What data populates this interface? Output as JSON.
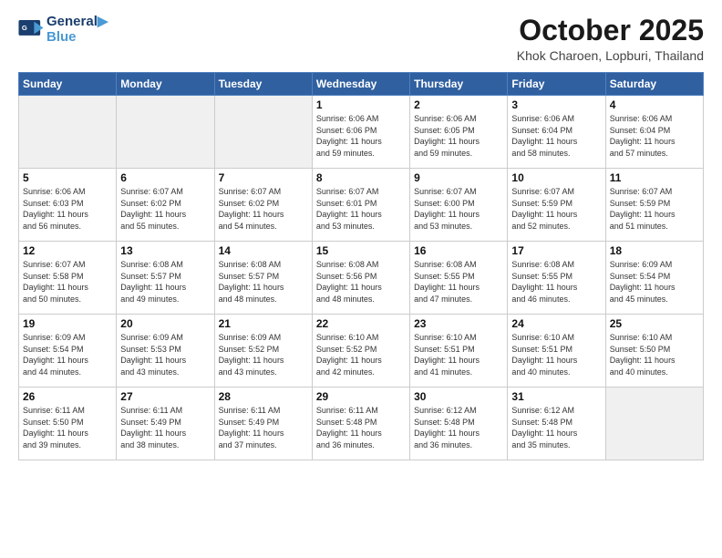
{
  "header": {
    "logo_line1": "General",
    "logo_line2": "Blue",
    "month": "October 2025",
    "location": "Khok Charoen, Lopburi, Thailand"
  },
  "weekdays": [
    "Sunday",
    "Monday",
    "Tuesday",
    "Wednesday",
    "Thursday",
    "Friday",
    "Saturday"
  ],
  "weeks": [
    [
      {
        "day": "",
        "lines": [],
        "empty": true
      },
      {
        "day": "",
        "lines": [],
        "empty": true
      },
      {
        "day": "",
        "lines": [],
        "empty": true
      },
      {
        "day": "1",
        "lines": [
          "Sunrise: 6:06 AM",
          "Sunset: 6:06 PM",
          "Daylight: 11 hours",
          "and 59 minutes."
        ],
        "empty": false
      },
      {
        "day": "2",
        "lines": [
          "Sunrise: 6:06 AM",
          "Sunset: 6:05 PM",
          "Daylight: 11 hours",
          "and 59 minutes."
        ],
        "empty": false
      },
      {
        "day": "3",
        "lines": [
          "Sunrise: 6:06 AM",
          "Sunset: 6:04 PM",
          "Daylight: 11 hours",
          "and 58 minutes."
        ],
        "empty": false
      },
      {
        "day": "4",
        "lines": [
          "Sunrise: 6:06 AM",
          "Sunset: 6:04 PM",
          "Daylight: 11 hours",
          "and 57 minutes."
        ],
        "empty": false
      }
    ],
    [
      {
        "day": "5",
        "lines": [
          "Sunrise: 6:06 AM",
          "Sunset: 6:03 PM",
          "Daylight: 11 hours",
          "and 56 minutes."
        ],
        "empty": false
      },
      {
        "day": "6",
        "lines": [
          "Sunrise: 6:07 AM",
          "Sunset: 6:02 PM",
          "Daylight: 11 hours",
          "and 55 minutes."
        ],
        "empty": false
      },
      {
        "day": "7",
        "lines": [
          "Sunrise: 6:07 AM",
          "Sunset: 6:02 PM",
          "Daylight: 11 hours",
          "and 54 minutes."
        ],
        "empty": false
      },
      {
        "day": "8",
        "lines": [
          "Sunrise: 6:07 AM",
          "Sunset: 6:01 PM",
          "Daylight: 11 hours",
          "and 53 minutes."
        ],
        "empty": false
      },
      {
        "day": "9",
        "lines": [
          "Sunrise: 6:07 AM",
          "Sunset: 6:00 PM",
          "Daylight: 11 hours",
          "and 53 minutes."
        ],
        "empty": false
      },
      {
        "day": "10",
        "lines": [
          "Sunrise: 6:07 AM",
          "Sunset: 5:59 PM",
          "Daylight: 11 hours",
          "and 52 minutes."
        ],
        "empty": false
      },
      {
        "day": "11",
        "lines": [
          "Sunrise: 6:07 AM",
          "Sunset: 5:59 PM",
          "Daylight: 11 hours",
          "and 51 minutes."
        ],
        "empty": false
      }
    ],
    [
      {
        "day": "12",
        "lines": [
          "Sunrise: 6:07 AM",
          "Sunset: 5:58 PM",
          "Daylight: 11 hours",
          "and 50 minutes."
        ],
        "empty": false
      },
      {
        "day": "13",
        "lines": [
          "Sunrise: 6:08 AM",
          "Sunset: 5:57 PM",
          "Daylight: 11 hours",
          "and 49 minutes."
        ],
        "empty": false
      },
      {
        "day": "14",
        "lines": [
          "Sunrise: 6:08 AM",
          "Sunset: 5:57 PM",
          "Daylight: 11 hours",
          "and 48 minutes."
        ],
        "empty": false
      },
      {
        "day": "15",
        "lines": [
          "Sunrise: 6:08 AM",
          "Sunset: 5:56 PM",
          "Daylight: 11 hours",
          "and 48 minutes."
        ],
        "empty": false
      },
      {
        "day": "16",
        "lines": [
          "Sunrise: 6:08 AM",
          "Sunset: 5:55 PM",
          "Daylight: 11 hours",
          "and 47 minutes."
        ],
        "empty": false
      },
      {
        "day": "17",
        "lines": [
          "Sunrise: 6:08 AM",
          "Sunset: 5:55 PM",
          "Daylight: 11 hours",
          "and 46 minutes."
        ],
        "empty": false
      },
      {
        "day": "18",
        "lines": [
          "Sunrise: 6:09 AM",
          "Sunset: 5:54 PM",
          "Daylight: 11 hours",
          "and 45 minutes."
        ],
        "empty": false
      }
    ],
    [
      {
        "day": "19",
        "lines": [
          "Sunrise: 6:09 AM",
          "Sunset: 5:54 PM",
          "Daylight: 11 hours",
          "and 44 minutes."
        ],
        "empty": false
      },
      {
        "day": "20",
        "lines": [
          "Sunrise: 6:09 AM",
          "Sunset: 5:53 PM",
          "Daylight: 11 hours",
          "and 43 minutes."
        ],
        "empty": false
      },
      {
        "day": "21",
        "lines": [
          "Sunrise: 6:09 AM",
          "Sunset: 5:52 PM",
          "Daylight: 11 hours",
          "and 43 minutes."
        ],
        "empty": false
      },
      {
        "day": "22",
        "lines": [
          "Sunrise: 6:10 AM",
          "Sunset: 5:52 PM",
          "Daylight: 11 hours",
          "and 42 minutes."
        ],
        "empty": false
      },
      {
        "day": "23",
        "lines": [
          "Sunrise: 6:10 AM",
          "Sunset: 5:51 PM",
          "Daylight: 11 hours",
          "and 41 minutes."
        ],
        "empty": false
      },
      {
        "day": "24",
        "lines": [
          "Sunrise: 6:10 AM",
          "Sunset: 5:51 PM",
          "Daylight: 11 hours",
          "and 40 minutes."
        ],
        "empty": false
      },
      {
        "day": "25",
        "lines": [
          "Sunrise: 6:10 AM",
          "Sunset: 5:50 PM",
          "Daylight: 11 hours",
          "and 40 minutes."
        ],
        "empty": false
      }
    ],
    [
      {
        "day": "26",
        "lines": [
          "Sunrise: 6:11 AM",
          "Sunset: 5:50 PM",
          "Daylight: 11 hours",
          "and 39 minutes."
        ],
        "empty": false
      },
      {
        "day": "27",
        "lines": [
          "Sunrise: 6:11 AM",
          "Sunset: 5:49 PM",
          "Daylight: 11 hours",
          "and 38 minutes."
        ],
        "empty": false
      },
      {
        "day": "28",
        "lines": [
          "Sunrise: 6:11 AM",
          "Sunset: 5:49 PM",
          "Daylight: 11 hours",
          "and 37 minutes."
        ],
        "empty": false
      },
      {
        "day": "29",
        "lines": [
          "Sunrise: 6:11 AM",
          "Sunset: 5:48 PM",
          "Daylight: 11 hours",
          "and 36 minutes."
        ],
        "empty": false
      },
      {
        "day": "30",
        "lines": [
          "Sunrise: 6:12 AM",
          "Sunset: 5:48 PM",
          "Daylight: 11 hours",
          "and 36 minutes."
        ],
        "empty": false
      },
      {
        "day": "31",
        "lines": [
          "Sunrise: 6:12 AM",
          "Sunset: 5:48 PM",
          "Daylight: 11 hours",
          "and 35 minutes."
        ],
        "empty": false
      },
      {
        "day": "",
        "lines": [],
        "empty": true
      }
    ]
  ]
}
